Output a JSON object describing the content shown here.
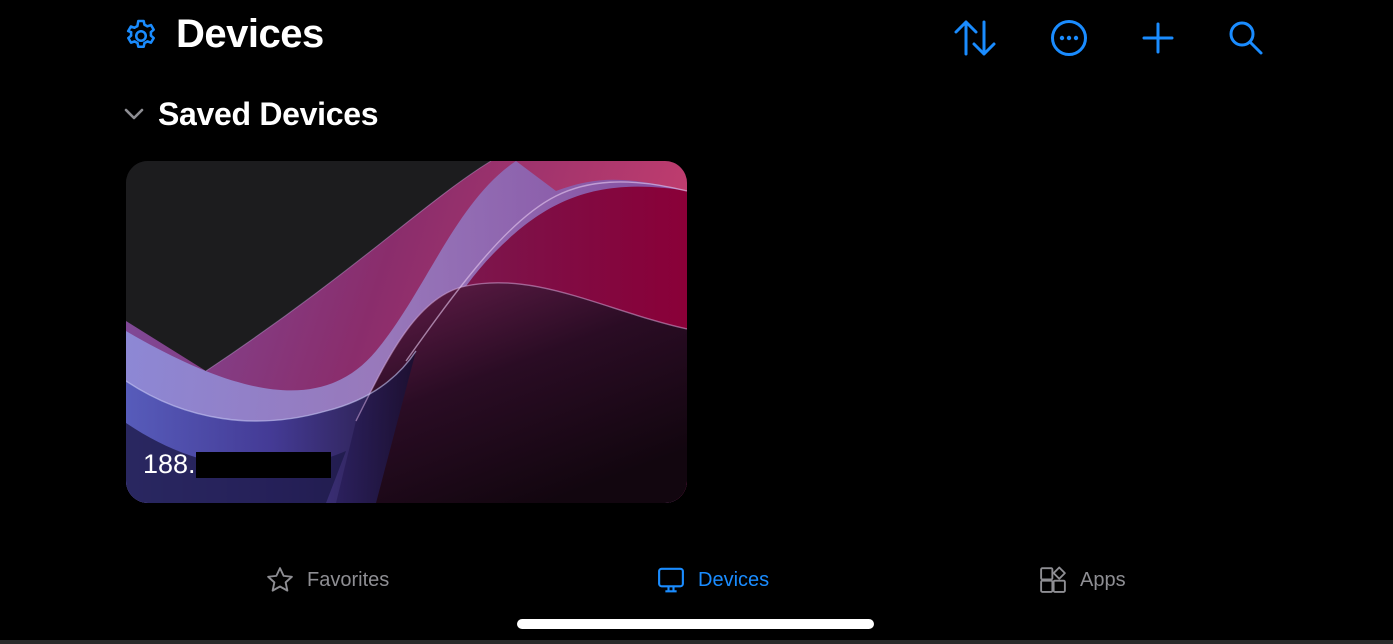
{
  "header": {
    "title": "Devices",
    "settings_icon": "gear-icon",
    "actions": [
      {
        "name": "sort-button",
        "icon": "arrow-up-down-icon"
      },
      {
        "name": "more-button",
        "icon": "ellipsis-circle-icon"
      },
      {
        "name": "add-button",
        "icon": "plus-icon"
      },
      {
        "name": "search-button",
        "icon": "magnifier-icon"
      }
    ]
  },
  "section": {
    "label": "Saved Devices",
    "expanded": true
  },
  "devices": [
    {
      "name_visible": "188.",
      "name_redacted": true
    }
  ],
  "tabbar": {
    "tabs": [
      {
        "label": "Favorites",
        "icon": "star-icon",
        "active": false
      },
      {
        "label": "Devices",
        "icon": "monitor-icon",
        "active": true
      },
      {
        "label": "Apps",
        "icon": "apps-icon",
        "active": false
      }
    ]
  },
  "colors": {
    "accent": "#1a8cff",
    "inactive": "#8e8e93",
    "background": "#000000",
    "card_background": "#1c1c1e"
  }
}
